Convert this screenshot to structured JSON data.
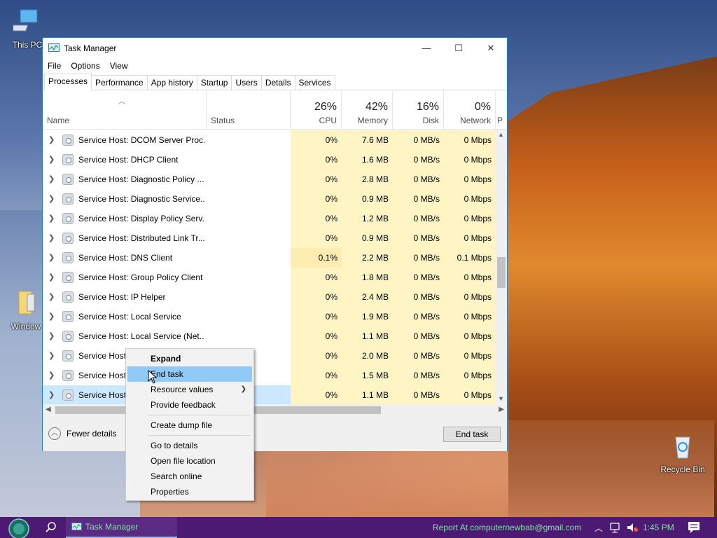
{
  "desktop": {
    "icons": {
      "this_pc": "This PC",
      "windows_folder": "Window",
      "recycle_bin": "Recycle Bin"
    }
  },
  "window": {
    "title": "Task Manager",
    "caption": {
      "minimize": "—",
      "maximize": "☐",
      "close": "✕"
    },
    "menu": [
      "File",
      "Options",
      "View"
    ],
    "tabs": [
      "Processes",
      "Performance",
      "App history",
      "Startup",
      "Users",
      "Details",
      "Services"
    ],
    "active_tab": "Processes",
    "columns": {
      "name": "Name",
      "status": "Status",
      "cpu": {
        "pct": "26%",
        "label": "CPU"
      },
      "memory": {
        "pct": "42%",
        "label": "Memory"
      },
      "disk": {
        "pct": "16%",
        "label": "Disk"
      },
      "network": {
        "pct": "0%",
        "label": "Network"
      },
      "power": "P"
    },
    "rows": [
      {
        "name": "Service Host: DCOM Server Proc...",
        "cpu": "0%",
        "mem": "7.6 MB",
        "disk": "0 MB/s",
        "net": "0 Mbps"
      },
      {
        "name": "Service Host: DHCP Client",
        "cpu": "0%",
        "mem": "1.6 MB",
        "disk": "0 MB/s",
        "net": "0 Mbps"
      },
      {
        "name": "Service Host: Diagnostic Policy ...",
        "cpu": "0%",
        "mem": "2.8 MB",
        "disk": "0 MB/s",
        "net": "0 Mbps"
      },
      {
        "name": "Service Host: Diagnostic Service...",
        "cpu": "0%",
        "mem": "0.9 MB",
        "disk": "0 MB/s",
        "net": "0 Mbps"
      },
      {
        "name": "Service Host: Display Policy Serv...",
        "cpu": "0%",
        "mem": "1.2 MB",
        "disk": "0 MB/s",
        "net": "0 Mbps"
      },
      {
        "name": "Service Host: Distributed Link Tr...",
        "cpu": "0%",
        "mem": "0.9 MB",
        "disk": "0 MB/s",
        "net": "0 Mbps"
      },
      {
        "name": "Service Host: DNS Client",
        "cpu": "0.1%",
        "mem": "2.2 MB",
        "disk": "0 MB/s",
        "net": "0.1 Mbps"
      },
      {
        "name": "Service Host: Group Policy Client",
        "cpu": "0%",
        "mem": "1.8 MB",
        "disk": "0 MB/s",
        "net": "0 Mbps"
      },
      {
        "name": "Service Host: IP Helper",
        "cpu": "0%",
        "mem": "2.4 MB",
        "disk": "0 MB/s",
        "net": "0 Mbps"
      },
      {
        "name": "Service Host: Local Service",
        "cpu": "0%",
        "mem": "1.9 MB",
        "disk": "0 MB/s",
        "net": "0 Mbps"
      },
      {
        "name": "Service Host: Local Service (Net...",
        "cpu": "0%",
        "mem": "1.1 MB",
        "disk": "0 MB/s",
        "net": "0 Mbps"
      },
      {
        "name": "Service Host:",
        "cpu": "0%",
        "mem": "2.0 MB",
        "disk": "0 MB/s",
        "net": "0 Mbps"
      },
      {
        "name": "Service Host:",
        "cpu": "0%",
        "mem": "1.5 MB",
        "disk": "0 MB/s",
        "net": "0 Mbps"
      },
      {
        "name": "Service Host:",
        "cpu": "0%",
        "mem": "1.1 MB",
        "disk": "0 MB/s",
        "net": "0 Mbps"
      }
    ],
    "selected_row": 13,
    "footer": {
      "fewer_details": "Fewer details",
      "end_task": "End task"
    }
  },
  "context_menu": {
    "groups": [
      [
        {
          "label": "Expand",
          "bold": true
        },
        {
          "label": "End task",
          "hover": true
        },
        {
          "label": "Resource values",
          "submenu": true
        },
        {
          "label": "Provide feedback"
        }
      ],
      [
        {
          "label": "Create dump file"
        }
      ],
      [
        {
          "label": "Go to details"
        },
        {
          "label": "Open file location"
        },
        {
          "label": "Search online"
        },
        {
          "label": "Properties"
        }
      ]
    ]
  },
  "taskbar": {
    "app_label": "Task Manager",
    "report_text": "Report At computernewbab@gmail.com",
    "clock": "1:45 PM",
    "accent_text_color": "#7ee6a0",
    "background": "#4c1a72"
  }
}
